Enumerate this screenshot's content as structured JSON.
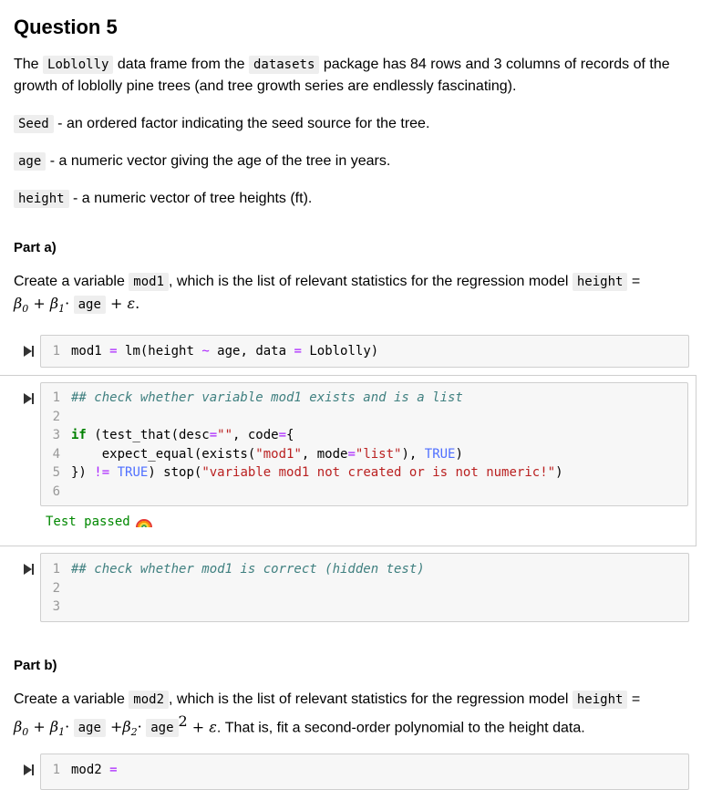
{
  "question": {
    "title": "Question 5",
    "intro": {
      "t1": "The ",
      "c1": "Loblolly",
      "t2": " data frame from the ",
      "c2": "datasets",
      "t3": " package has 84 rows and 3 columns of records of the growth of loblolly pine trees (and tree growth series are endlessly fascinating)."
    },
    "columns": [
      {
        "name": "Seed",
        "desc": " - an ordered factor indicating the seed source for the tree."
      },
      {
        "name": "age",
        "desc": " - a numeric vector giving the age of the tree in years."
      },
      {
        "name": "height",
        "desc": " - a numeric vector of tree heights (ft)."
      }
    ]
  },
  "part_a": {
    "heading": "Part a)",
    "t1": "Create a variable ",
    "c1": "mod1",
    "t2": ", which is the list of relevant statistics for the regression model ",
    "c2": "height",
    "eq": " =",
    "m_beta0": "β",
    "m_sub0": "0",
    "m_plus": " + ",
    "m_beta1": "β",
    "m_sub1": "1",
    "m_dot": "·",
    "c3": "age",
    "m_plus2": " +",
    "m_eps": "ε",
    "m_end": "."
  },
  "cells": {
    "cell1": {
      "ln": [
        "1"
      ],
      "code": [
        [
          "mod1 ",
          "=",
          " lm(height ",
          "~",
          " age, data ",
          "=",
          " Loblolly)"
        ]
      ]
    },
    "cell2": {
      "ln": [
        "1",
        "2",
        "3",
        "4",
        "5",
        "6"
      ],
      "l1": "## check whether variable mod1 exists and is a list",
      "l3a": "if",
      "l3b": " (test_that(desc",
      "l3c": "=",
      "l3d": "\"\"",
      "l3e": ", code",
      "l3f": "=",
      "l3g": "{",
      "l4a": "    expect_equal(exists(",
      "l4b": "\"mod1\"",
      "l4c": ", mode",
      "l4d": "=",
      "l4e": "\"list\"",
      "l4f": "), ",
      "l4g": "TRUE",
      "l4h": ")",
      "l5a": "}) ",
      "l5b": "!=",
      "l5c": " ",
      "l5d": "TRUE",
      "l5e": ") stop(",
      "l5f": "\"variable mod1 not created or is not numeric!\"",
      "l5g": ")",
      "output": "Test passed"
    },
    "cell3": {
      "ln": [
        "1",
        "2",
        "3"
      ],
      "l1": "## check whether mod1 is correct (hidden test)"
    },
    "cell4": {
      "ln": [
        "1"
      ],
      "l1a": "mod2 ",
      "l1b": "="
    }
  },
  "part_b": {
    "heading": "Part b)",
    "t1": "Create a variable ",
    "c1": "mod2",
    "t2": ", which is the list of relevant statistics for the regression model ",
    "c2": "height",
    "eq": " =",
    "m_beta0": "β",
    "m_sub0": "0",
    "m_plus": " + ",
    "m_beta1": "β",
    "m_sub1": "1",
    "m_dot": "·",
    "c3": "age",
    "m_plus2": " +",
    "m_beta2": "β",
    "m_sub2": "2",
    "m_dot2": "·",
    "c4": "age",
    "m_sq": "2",
    "m_plus3": " + ",
    "m_eps": "ε",
    "t3": ". That is, fit a second-order polynomial to the height data."
  },
  "colors": {
    "comment": "#408080",
    "keyword": "#008000",
    "string": "#BA2121",
    "operator": "#AA22FF",
    "builtin": "#4f6fff",
    "output": "#008800"
  },
  "icons": {
    "run": "run-cell-icon",
    "rainbow": "rainbow-icon"
  }
}
